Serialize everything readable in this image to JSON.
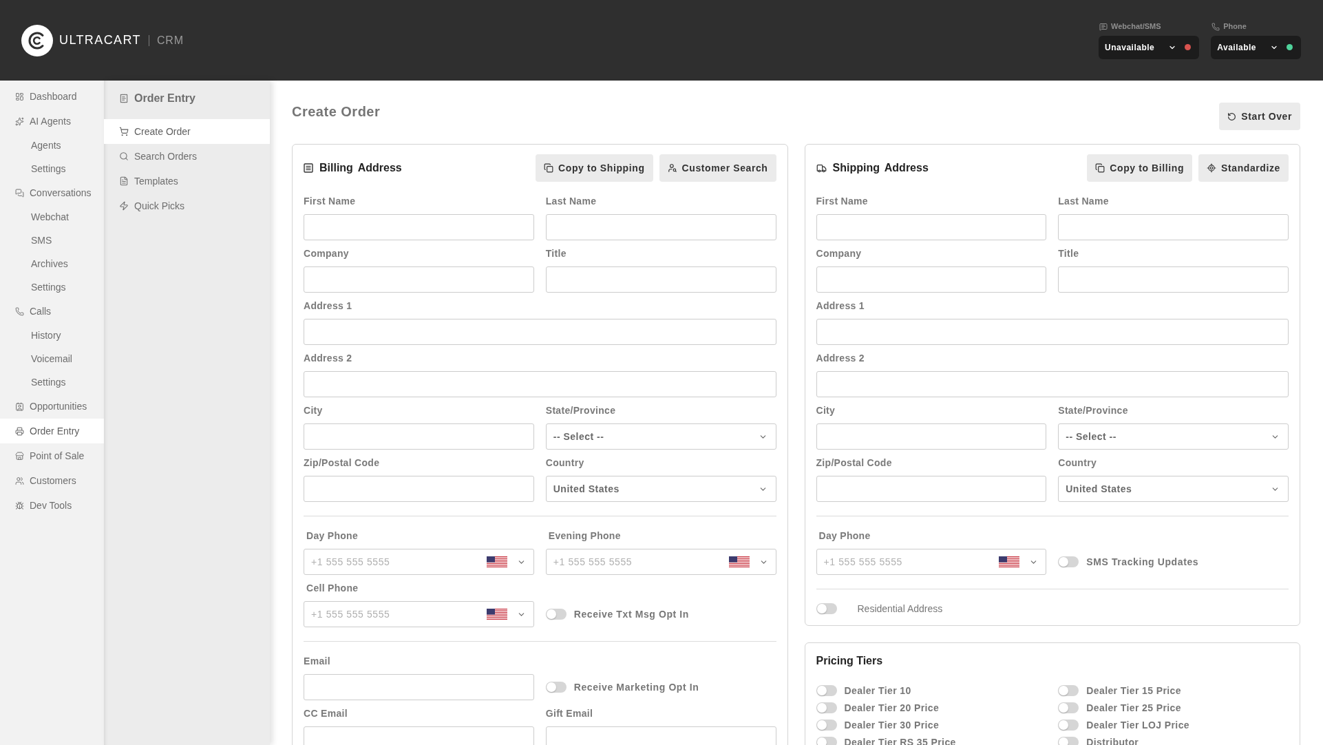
{
  "header": {
    "brand": "ULTRACART",
    "product": "CRM",
    "presence": [
      {
        "channel": "Webchat/SMS",
        "status": "Unavailable",
        "color": "#d9534f"
      },
      {
        "channel": "Phone",
        "status": "Available",
        "color": "#4fd39b"
      }
    ]
  },
  "sidebar": {
    "items": [
      {
        "label": "Dashboard",
        "selected": false
      },
      {
        "label": "AI Agents",
        "selected": false,
        "children": [
          {
            "label": "Agents",
            "selected": false
          },
          {
            "label": "Settings",
            "selected": false
          }
        ]
      },
      {
        "label": "Conversations",
        "selected": false,
        "children": [
          {
            "label": "Webchat",
            "selected": false
          },
          {
            "label": "SMS",
            "selected": false
          },
          {
            "label": "Archives",
            "selected": false
          },
          {
            "label": "Settings",
            "selected": false
          }
        ]
      },
      {
        "label": "Calls",
        "selected": false,
        "children": [
          {
            "label": "History",
            "selected": false
          },
          {
            "label": "Voicemail",
            "selected": false
          },
          {
            "label": "Settings",
            "selected": false
          }
        ]
      },
      {
        "label": "Opportunities",
        "selected": false
      },
      {
        "label": "Order Entry",
        "selected": true
      },
      {
        "label": "Point of Sale",
        "selected": false
      },
      {
        "label": "Customers",
        "selected": false
      },
      {
        "label": "Dev Tools",
        "selected": false
      }
    ]
  },
  "subnav": {
    "title": "Order Entry",
    "items": [
      {
        "label": "Create Order",
        "selected": true
      },
      {
        "label": "Search Orders",
        "selected": false
      },
      {
        "label": "Templates",
        "selected": false
      },
      {
        "label": "Quick Picks",
        "selected": false
      }
    ]
  },
  "page": {
    "title": "Create Order",
    "actions": [
      {
        "label": "Start Over"
      }
    ]
  },
  "billing": {
    "title": "Billing Address",
    "actions": [
      {
        "label": "Copy to Shipping"
      },
      {
        "label": "Customer Search"
      }
    ],
    "sections": [
      {
        "rows": [
          [
            {
              "kind": "text",
              "label": "First Name"
            },
            {
              "kind": "text",
              "label": "Last Name"
            }
          ],
          [
            {
              "kind": "text",
              "label": "Company"
            },
            {
              "kind": "text",
              "label": "Title"
            }
          ],
          [
            {
              "kind": "text",
              "label": "Address 1"
            }
          ],
          [
            {
              "kind": "text",
              "label": "Address 2"
            }
          ],
          [
            {
              "kind": "text",
              "label": "City"
            },
            {
              "kind": "select",
              "label": "State/Province",
              "value": "-- Select --"
            }
          ],
          [
            {
              "kind": "text",
              "label": "Zip/Postal Code"
            },
            {
              "kind": "select",
              "label": "Country",
              "value": "United States"
            }
          ]
        ]
      },
      {
        "rows": [
          [
            {
              "kind": "phone",
              "label": "Day Phone",
              "placeholder": "+1 555 555 5555"
            },
            {
              "kind": "phone",
              "label": "Evening Phone",
              "placeholder": "+1 555 555 5555"
            }
          ],
          [
            {
              "kind": "phone",
              "label": "Cell Phone",
              "placeholder": "+1 555 555 5555"
            },
            {
              "kind": "toggle",
              "label": "Receive Txt Msg Opt In",
              "on": false
            }
          ]
        ]
      },
      {
        "rows": [
          [
            {
              "kind": "text",
              "label": "Email"
            },
            {
              "kind": "toggle",
              "label": "Receive Marketing Opt In",
              "on": false
            }
          ],
          [
            {
              "kind": "text",
              "label": "CC Email"
            },
            {
              "kind": "text",
              "label": "Gift Email"
            }
          ]
        ]
      }
    ]
  },
  "shipping": {
    "title": "Shipping Address",
    "actions": [
      {
        "label": "Copy to Billing"
      },
      {
        "label": "Standardize"
      }
    ],
    "sections": [
      {
        "rows": [
          [
            {
              "kind": "text",
              "label": "First Name"
            },
            {
              "kind": "text",
              "label": "Last Name"
            }
          ],
          [
            {
              "kind": "text",
              "label": "Company"
            },
            {
              "kind": "text",
              "label": "Title"
            }
          ],
          [
            {
              "kind": "text",
              "label": "Address 1"
            }
          ],
          [
            {
              "kind": "text",
              "label": "Address 2"
            }
          ],
          [
            {
              "kind": "text",
              "label": "City"
            },
            {
              "kind": "select",
              "label": "State/Province",
              "value": "-- Select --"
            }
          ],
          [
            {
              "kind": "text",
              "label": "Zip/Postal Code"
            },
            {
              "kind": "select",
              "label": "Country",
              "value": "United States"
            }
          ]
        ]
      },
      {
        "rows": [
          [
            {
              "kind": "phone",
              "label": "Day Phone",
              "placeholder": "+1 555 555 5555"
            },
            {
              "kind": "toggle",
              "label": "SMS Tracking Updates",
              "on": false
            }
          ]
        ]
      },
      {
        "rows": [
          [
            {
              "kind": "setting",
              "label": "Residential Address",
              "on": false
            }
          ]
        ]
      }
    ]
  },
  "pricing_tiers": {
    "title": "Pricing Tiers",
    "tiers": [
      {
        "label": "Dealer Tier 10",
        "on": false
      },
      {
        "label": "Dealer Tier 15 Price",
        "on": false
      },
      {
        "label": "Dealer Tier 20 Price",
        "on": false
      },
      {
        "label": "Dealer Tier 25 Price",
        "on": false
      },
      {
        "label": "Dealer Tier 30 Price",
        "on": false
      },
      {
        "label": "Dealer Tier LOJ Price",
        "on": false
      },
      {
        "label": "Dealer Tier RS 35 Price",
        "on": false
      },
      {
        "label": "Distributor",
        "on": false
      }
    ]
  }
}
